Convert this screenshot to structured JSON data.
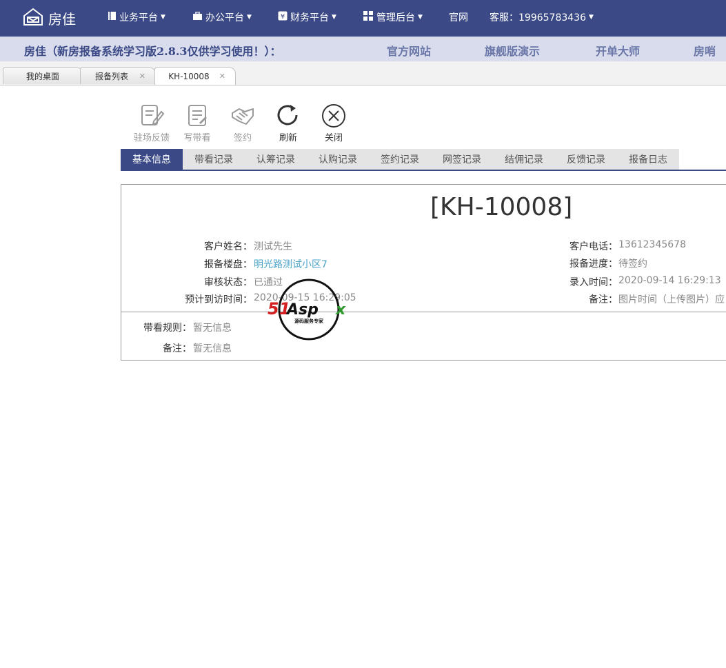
{
  "app": {
    "logo_text": "房佳",
    "nav": [
      {
        "label": "业务平台",
        "icon": "book-icon"
      },
      {
        "label": "办公平台",
        "icon": "briefcase-icon"
      },
      {
        "label": "财务平台",
        "icon": "yen-icon"
      },
      {
        "label": "管理后台",
        "icon": "grid-icon"
      },
      {
        "label": "官网"
      },
      {
        "label": "客服：19965783436"
      }
    ]
  },
  "banner": {
    "title": "房佳（新房报备系统学习版2.8.3仅供学习使用！）：",
    "links": [
      "官方网站",
      "旗舰版演示",
      "开单大师",
      "房哨"
    ]
  },
  "tabs": [
    {
      "label": "我的桌面"
    },
    {
      "label": "报备列表"
    },
    {
      "label": "KH-10008"
    }
  ],
  "toolbar": [
    {
      "label": "驻场反馈",
      "icon": "feedback-icon"
    },
    {
      "label": "写带看",
      "icon": "write-icon"
    },
    {
      "label": "签约",
      "icon": "handshake-icon"
    },
    {
      "label": "刷新",
      "icon": "refresh-icon"
    },
    {
      "label": "关闭",
      "icon": "close-icon"
    }
  ],
  "subtabs": [
    "基本信息",
    "带看记录",
    "认筹记录",
    "认购记录",
    "签约记录",
    "网签记录",
    "结佣记录",
    "反馈记录",
    "报备日志"
  ],
  "record": {
    "title": "[KH-10008]",
    "fields_left": [
      {
        "label": "客户姓名：",
        "value": "测试先生"
      },
      {
        "label": "报备楼盘：",
        "value": "明光路测试小区7"
      },
      {
        "label": "审核状态：",
        "value": "已通过"
      },
      {
        "label": "预计到访时间：",
        "value": "2020-09-15 16:29:05"
      }
    ],
    "fields_right": [
      {
        "label": "客户电话：",
        "value": "13612345678"
      },
      {
        "label": "报备进度：",
        "value": "待签约"
      },
      {
        "label": "录入时间：",
        "value": "2020-09-14 16:29:13"
      },
      {
        "label": "备注：",
        "value": "图片时间（上传图片）应"
      }
    ],
    "rules_label": "带看规则：",
    "rules_value": "暂无信息",
    "note_label": "备注：",
    "note_value": "暂无信息"
  },
  "watermark": {
    "brand": "51Aspx",
    "tagline": "源码服务专家"
  },
  "colors": {
    "primary": "#3b4a86",
    "banner_bg": "#d8dcec",
    "link": "#4aa3c8",
    "tab_inactive": "#e4e4e4"
  }
}
